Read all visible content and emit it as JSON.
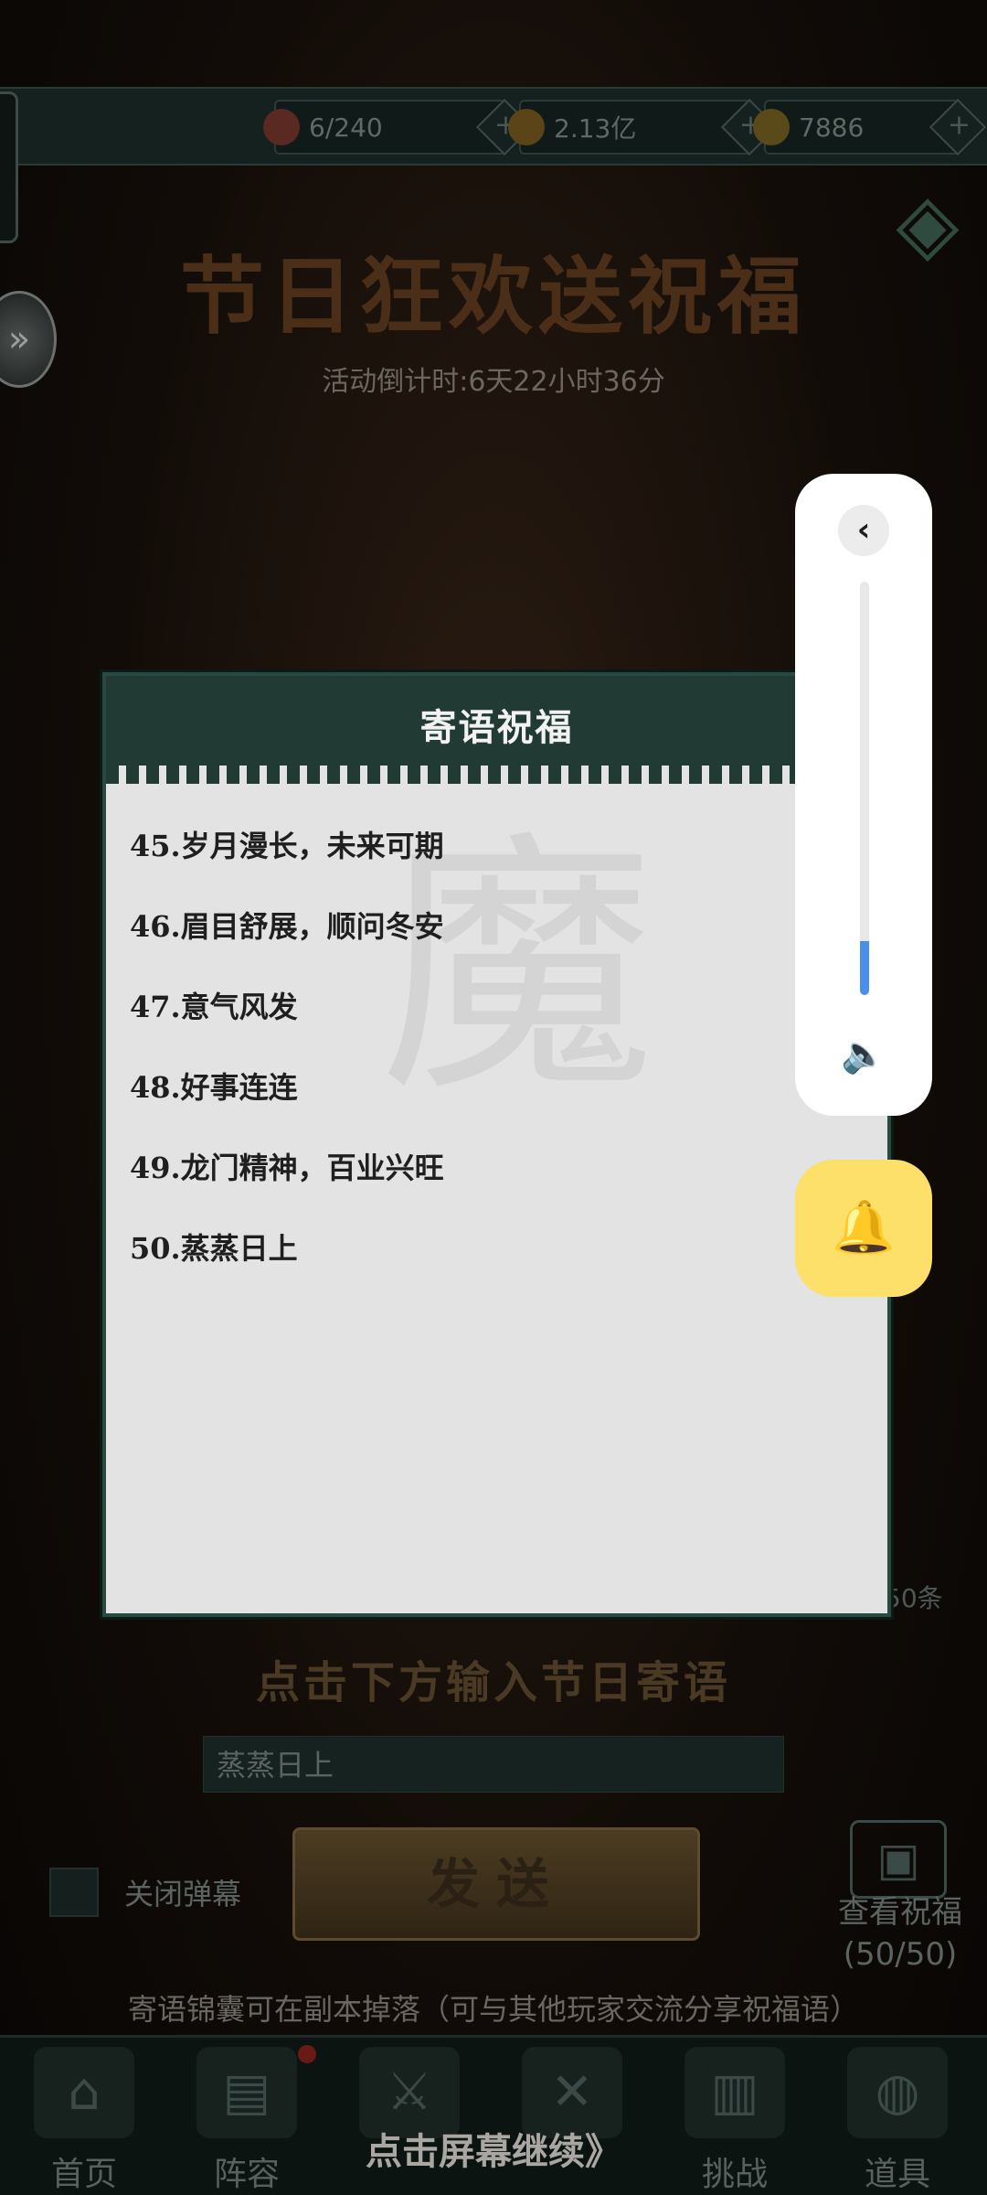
{
  "resources": [
    {
      "icon": "orb-icon",
      "value": "6/240",
      "color": "#5a2a22"
    },
    {
      "icon": "coin-icon",
      "value": "2.13亿",
      "color": "#5a4418"
    },
    {
      "icon": "ingot-icon",
      "value": "7886",
      "color": "#5a4a1a"
    }
  ],
  "event": {
    "title": "节日狂欢送祝福",
    "countdown": "活动倒计时:6天22小时36分"
  },
  "dialog": {
    "title": "寄语祝福",
    "items": [
      "45.岁月漫长，未来可期",
      "46.眉目舒展，顺问冬安",
      "47.意气风发",
      "48.好事连连",
      "49.龙门精神，百业兴旺",
      "50.蒸蒸日上"
    ]
  },
  "volume": {
    "level_fraction": 0.13,
    "accent": "#4a90e8"
  },
  "blessing_count": "50条",
  "input_prompt": "点击下方输入节日寄语",
  "input_value": "蒸蒸日上",
  "close_danmaku_label": "关闭弹幕",
  "send_label": "发送",
  "view_blessing": {
    "label": "查看祝福",
    "count": "(50/50)"
  },
  "hint": "寄语锦囊可在副本掉落（可与其他玩家交流分享祝福语）",
  "nav": [
    {
      "label": "首页",
      "icon": "home-icon"
    },
    {
      "label": "阵容",
      "icon": "lineup-icon"
    },
    {
      "label": "",
      "icon": "sword-icon"
    },
    {
      "label": "",
      "icon": "battle-icon"
    },
    {
      "label": "挑战",
      "icon": "scroll-icon"
    },
    {
      "label": "道具",
      "icon": "bag-icon"
    }
  ],
  "continue_text": "点击屏幕继续》"
}
